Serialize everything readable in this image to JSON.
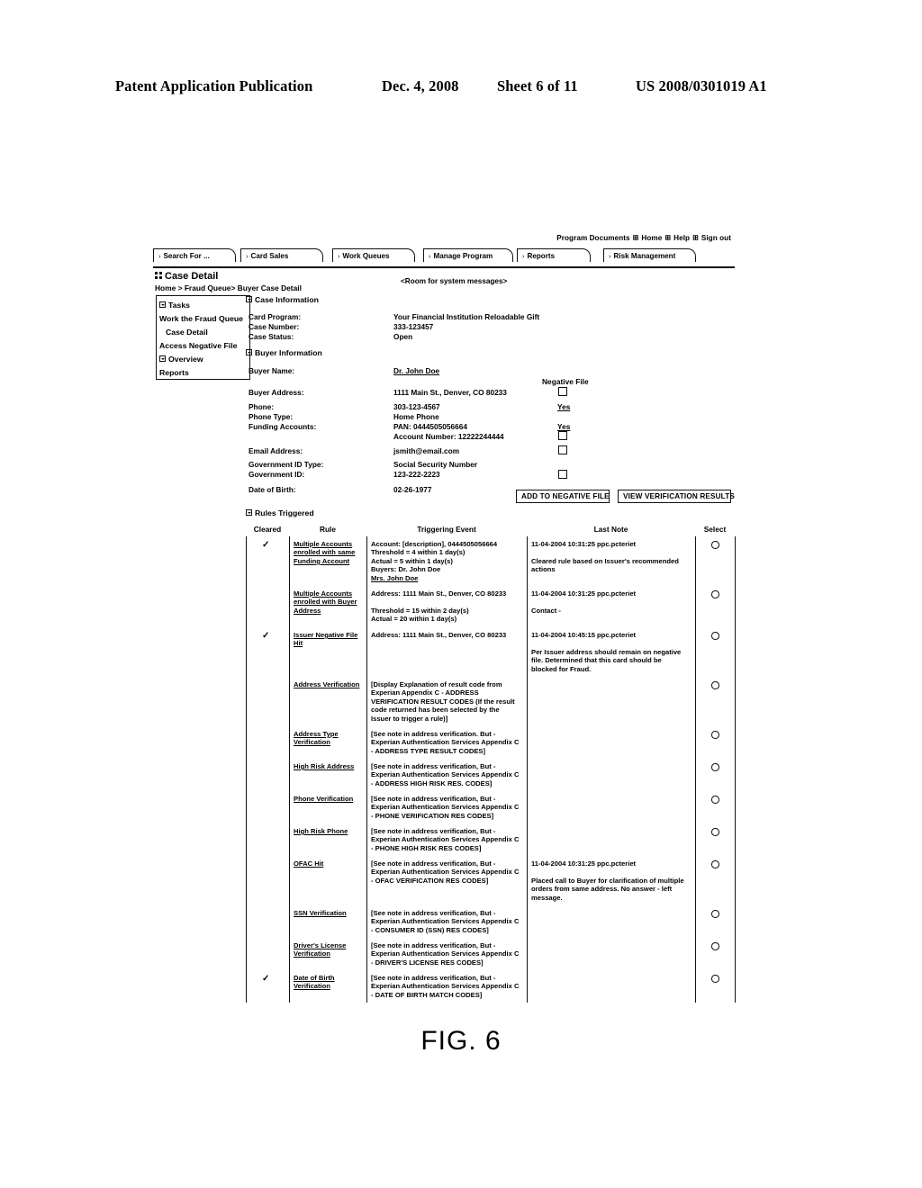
{
  "patent_header": {
    "publication": "Patent Application Publication",
    "date": "Dec. 4, 2008",
    "sheet": "Sheet 6 of 11",
    "number": "US 2008/0301019 A1"
  },
  "figure_caption": "FIG. 6",
  "utility_links": [
    "Program Documents",
    "Home",
    "Help",
    "Sign out"
  ],
  "tabs": [
    {
      "label": "Search For ..."
    },
    {
      "label": "Card Sales"
    },
    {
      "label": "Work Queues"
    },
    {
      "label": "Manage Program"
    },
    {
      "label": "Reports"
    },
    {
      "label": "Risk Management"
    }
  ],
  "page": {
    "title": "Case Detail",
    "breadcrumb": "Home > Fraud Queue> Buyer Case Detail",
    "system_message": "<Room  for system messages>"
  },
  "sidebar": {
    "items": [
      {
        "label": "Tasks",
        "expander": true,
        "indent": false
      },
      {
        "label": "Work the Fraud Queue",
        "expander": false,
        "indent": false
      },
      {
        "label": "Case Detail",
        "expander": false,
        "indent": true
      },
      {
        "label": "Access Negative File",
        "expander": false,
        "indent": false
      },
      {
        "label": "Overview",
        "expander": true,
        "indent": false
      },
      {
        "label": "Reports",
        "expander": false,
        "indent": false
      }
    ]
  },
  "case_information": {
    "section_label": "Case Information",
    "fields": [
      {
        "label": "Card Program:",
        "value": "Your Financial Institution Reloadable Gift"
      },
      {
        "label": "Case Number:",
        "value": "333-123457"
      },
      {
        "label": "Case Status:",
        "value": "Open"
      }
    ]
  },
  "buyer_information": {
    "section_label": "Buyer Information",
    "negative_file_header": "Negative File",
    "buyer_name_label": "Buyer Name:",
    "buyer_name_value": "Dr. John Doe",
    "fields": [
      {
        "label": "Buyer Address:",
        "value": "1111 Main St., Denver, CO 80233"
      },
      {
        "label": "Phone:",
        "value": "303-123-4567"
      },
      {
        "label": "Phone Type:",
        "value": "Home Phone"
      },
      {
        "label": "Funding Accounts:",
        "value": "PAN: 0444505056664"
      },
      {
        "label": "",
        "value": "Account Number: 12222244444"
      },
      {
        "label": "Email Address:",
        "value": "jsmith@email.com"
      },
      {
        "label": "Government ID Type:",
        "value": "Social Security Number"
      },
      {
        "label": "Government ID:",
        "value": "123-222-2223"
      },
      {
        "label": "Date of Birth:",
        "value": "02-26-1977"
      }
    ],
    "negative_file_yes": "Yes"
  },
  "buttons": {
    "add_to_negative_file": "ADD TO NEGATIVE FILE",
    "view_verification_results": "VIEW VERIFICATION RESULTS"
  },
  "rules_triggered": {
    "section_label": "Rules Triggered",
    "columns": [
      "Cleared",
      "Rule",
      "Triggering Event",
      "Last Note",
      "Select"
    ],
    "rows": [
      {
        "cleared": true,
        "rule": "Multiple Accounts enrolled with same Funding Account",
        "event_lines": [
          {
            "text": "Account: [description], 0444505056664",
            "underline": false
          },
          {
            "text": "Threshold = 4 within 1 day(s)",
            "underline": false
          },
          {
            "text": "Actual = 5 within 1 day(s)",
            "underline": false
          },
          {
            "text": "Buyers: Dr. John Doe",
            "underline": false
          },
          {
            "text": "Mrs. John Doe",
            "underline": true
          }
        ],
        "note_lines": [
          "11-04-2004 10:31:25 ppc.pcteriet",
          "",
          "Cleared rule based on Issuer's recommended actions"
        ],
        "select": true
      },
      {
        "cleared": false,
        "rule": "Multiple Accounts enrolled with Buyer Address",
        "event_lines": [
          {
            "text": "Address: 1111 Main St., Denver, CO 80233",
            "underline": false
          },
          {
            "text": "",
            "underline": false
          },
          {
            "text": "Threshold = 15 within 2 day(s)",
            "underline": false
          },
          {
            "text": "Actual = 20 within 1 day(s)",
            "underline": false
          }
        ],
        "note_lines": [
          "11-04-2004 10:31:25 ppc.pcteriet",
          "",
          "Contact -"
        ],
        "select": true
      },
      {
        "cleared": true,
        "rule": "Issuer Negative File Hit",
        "event_lines": [
          {
            "text": "Address: 1111 Main St., Denver, CO 80233",
            "underline": false
          }
        ],
        "note_lines": [
          "11-04-2004 10:45:15 ppc.pcteriet",
          "",
          "Per Issuer address should remain on negative file. Determined that this card should be blocked for Fraud."
        ],
        "select": true
      },
      {
        "cleared": false,
        "rule": "Address Verification",
        "event_lines": [
          {
            "text": "[Display Explanation of result code from Experian Appendix C - ADDRESS VERIFICATION RESULT CODES (If the result code returned has been selected by the Issuer to trigger a rule)]",
            "underline": false
          }
        ],
        "note_lines": [],
        "select": true
      },
      {
        "cleared": false,
        "rule": "Address Type Verification",
        "event_lines": [
          {
            "text": "[See note in address verification. But - Experian Authentication Services Appendix C - ADDRESS TYPE RESULT CODES]",
            "underline": false
          }
        ],
        "note_lines": [],
        "select": true
      },
      {
        "cleared": false,
        "rule": "High Risk Address",
        "event_lines": [
          {
            "text": "[See note in address verification, But - Experian Authentication Services Appendix C - ADDRESS HIGH RISK RES. CODES]",
            "underline": false
          }
        ],
        "note_lines": [],
        "select": true
      },
      {
        "cleared": false,
        "rule": "Phone Verification",
        "event_lines": [
          {
            "text": "[See note in address verification, But - Experian Authentication Services Appendix C - PHONE VERIFICATION RES CODES]",
            "underline": false
          }
        ],
        "note_lines": [],
        "select": true
      },
      {
        "cleared": false,
        "rule": "High Risk Phone",
        "event_lines": [
          {
            "text": "[See note in address verification, But - Experian Authentication Services Appendix C - PHONE HIGH RISK RES CODES]",
            "underline": false
          }
        ],
        "note_lines": [],
        "select": true
      },
      {
        "cleared": false,
        "rule": "OFAC Hit",
        "event_lines": [
          {
            "text": "[See note in address verification, But - Experian Authentication Services Appendix C - OFAC VERIFICATION RES CODES]",
            "underline": false
          }
        ],
        "note_lines": [
          "11-04-2004 10:31:25 ppc.pcteriet",
          "",
          "Placed call to Buyer for clarification of multiple orders from same address. No answer - left message."
        ],
        "select": true
      },
      {
        "cleared": false,
        "rule": "SSN Verification",
        "event_lines": [
          {
            "text": "[See note in address verification, But - Experian Authentication Services Appendix C - CONSUMER ID (SSN) RES CODES]",
            "underline": false
          }
        ],
        "note_lines": [],
        "select": true
      },
      {
        "cleared": false,
        "rule": "Driver's License Verification",
        "event_lines": [
          {
            "text": "[See note in address verification, But - Experian Authentication Services Appendix C - DRIVER'S LICENSE RES CODES]",
            "underline": false
          }
        ],
        "note_lines": [],
        "select": true
      },
      {
        "cleared": true,
        "rule": "Date of Birth Verification",
        "event_lines": [
          {
            "text": "[See note in address verification, But - Experian Authentication Services Appendix C - DATE OF BIRTH MATCH CODES]",
            "underline": false
          }
        ],
        "note_lines": [],
        "select": true
      }
    ],
    "check_glyph": "✓"
  }
}
